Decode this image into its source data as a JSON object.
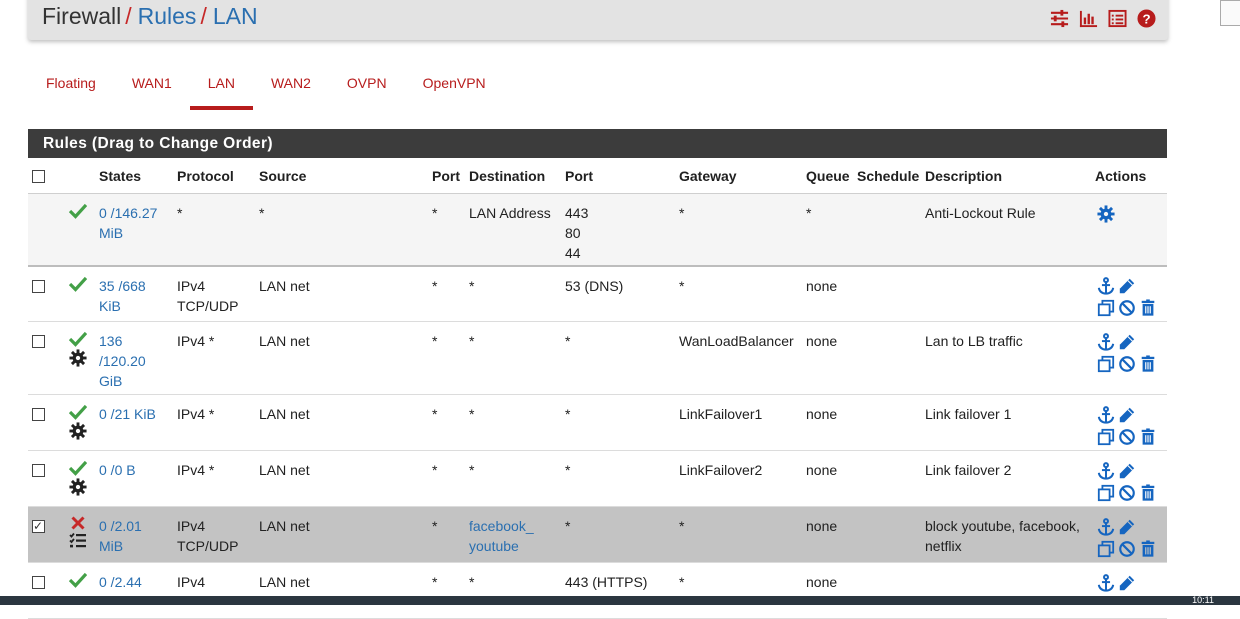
{
  "breadcrumb": {
    "part1": "Firewall",
    "sep": "/",
    "part2": "Rules",
    "part3": "LAN"
  },
  "header_icons": [
    "sliders-icon",
    "bar-chart-icon",
    "list-icon",
    "help-icon"
  ],
  "tabs": [
    {
      "label": "Floating"
    },
    {
      "label": "WAN1"
    },
    {
      "label": "LAN",
      "active": true
    },
    {
      "label": "WAN2"
    },
    {
      "label": "OVPN"
    },
    {
      "label": "OpenVPN"
    }
  ],
  "panel": {
    "title": "Rules (Drag to Change Order)"
  },
  "columns": {
    "states": "States",
    "protocol": "Protocol",
    "source": "Source",
    "port": "Port",
    "destination": "Destination",
    "port2": "Port",
    "gateway": "Gateway",
    "queue": "Queue",
    "schedule": "Schedule",
    "description": "Description",
    "actions": "Actions"
  },
  "rows": [
    {
      "states": "0 /146.27 MiB",
      "protocol": "*",
      "source": "*",
      "sport": "*",
      "dest": "LAN Address",
      "dport": "443\n80\n44",
      "gateway": "*",
      "queue": "*",
      "schedule": "",
      "desc": "Anti-Lockout Rule"
    },
    {
      "states": "35 /668 KiB",
      "protocol": "IPv4 TCP/UDP",
      "source": "LAN net",
      "sport": "*",
      "dest": "*",
      "dport": "53 (DNS)",
      "gateway": "*",
      "queue": "none",
      "schedule": "",
      "desc": ""
    },
    {
      "states": "136 /120.20 GiB",
      "protocol": "IPv4 *",
      "source": "LAN net",
      "sport": "*",
      "dest": "*",
      "dport": "*",
      "gateway": "WanLoadBalancer",
      "queue": "none",
      "schedule": "",
      "desc": "Lan to LB traffic"
    },
    {
      "states": "0 /21 KiB",
      "protocol": "IPv4 *",
      "source": "LAN net",
      "sport": "*",
      "dest": "*",
      "dport": "*",
      "gateway": "LinkFailover1",
      "queue": "none",
      "schedule": "",
      "desc": "Link failover 1"
    },
    {
      "states": "0 /0 B",
      "protocol": "IPv4 *",
      "source": "LAN net",
      "sport": "*",
      "dest": "*",
      "dport": "*",
      "gateway": "LinkFailover2",
      "queue": "none",
      "schedule": "",
      "desc": "Link failover 2"
    },
    {
      "states": "0 /2.01 MiB",
      "protocol": "IPv4 TCP/UDP",
      "source": "LAN net",
      "sport": "*",
      "dest": "facebook_ youtube",
      "dport": "*",
      "gateway": "*",
      "queue": "none",
      "schedule": "",
      "desc": "block youtube, facebook, netflix"
    },
    {
      "states": "0 /2.44",
      "protocol": "IPv4",
      "source": "LAN net",
      "sport": "*",
      "dest": "*",
      "dport": "443 (HTTPS)",
      "gateway": "*",
      "queue": "none",
      "schedule": "",
      "desc": ""
    }
  ],
  "taskbar": {
    "clock": "10:11"
  },
  "colors": {
    "accent_red": "#b71c1c",
    "link_blue": "#2a6fb0",
    "pass_green": "#43a047",
    "block_red": "#c62828",
    "action_blue": "#1565c0"
  }
}
